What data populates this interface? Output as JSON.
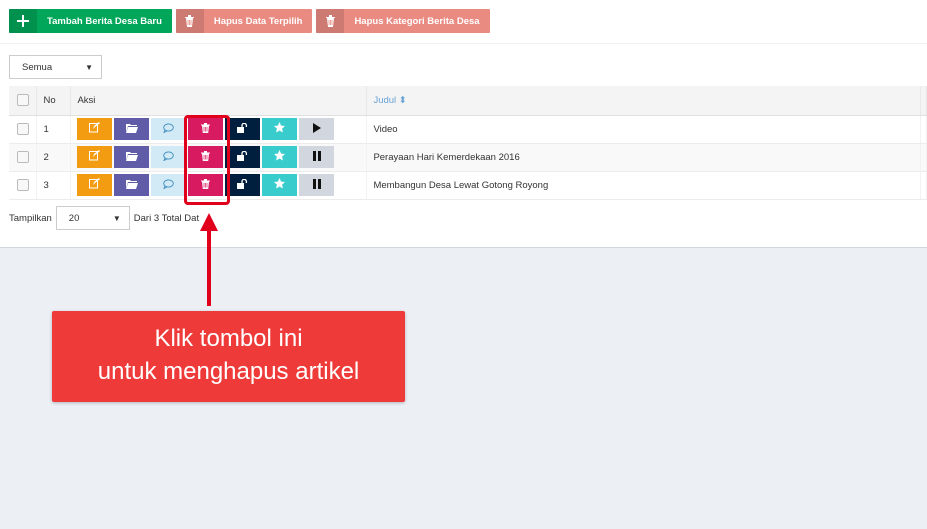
{
  "toolbar": {
    "add_label": "Tambah Berita Desa Baru",
    "delete_selected_label": "Hapus Data Terpilih",
    "delete_category_label": "Hapus Kategori Berita Desa"
  },
  "filter": {
    "selected": "Semua"
  },
  "table": {
    "headers": {
      "no": "No",
      "aksi": "Aksi",
      "judul": "Judul"
    },
    "rows": [
      {
        "no": "1",
        "judul": "Video",
        "toggle": "play"
      },
      {
        "no": "2",
        "judul": "Perayaan Hari Kemerdekaan 2016",
        "toggle": "pause"
      },
      {
        "no": "3",
        "judul": "Membangun Desa Lewat Gotong Royong",
        "toggle": "pause"
      }
    ]
  },
  "footer": {
    "show_label": "Tampilkan",
    "page_size": "20",
    "total_text": "Dari 3 Total Dat"
  },
  "annotation": {
    "line1": "Klik tombol ini",
    "line2": "untuk menghapus artikel"
  },
  "colors": {
    "add": "#00a65a",
    "delete": "#ea8b82",
    "edit": "#f39c12",
    "category": "#605ca8",
    "comment": "#d2e9f6",
    "remove": "#d81b60",
    "lock": "#001f3f",
    "star": "#39cccc",
    "callout": "#ef3a3a"
  }
}
